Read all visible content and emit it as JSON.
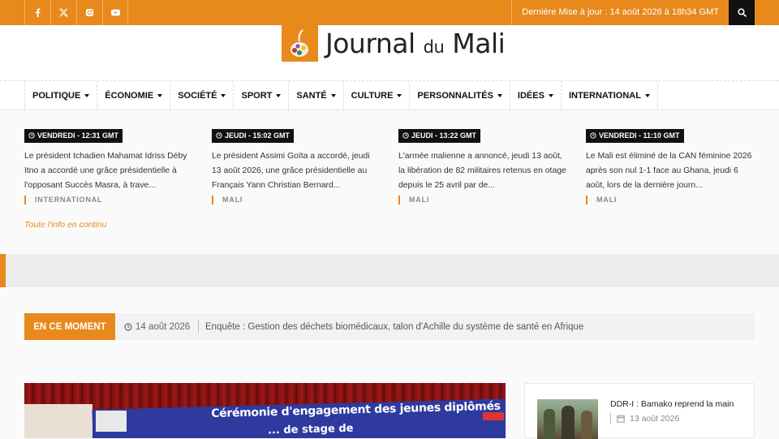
{
  "topbar": {
    "social_icons": [
      "facebook-icon",
      "x-twitter-icon",
      "instagram-icon",
      "youtube-icon"
    ],
    "updated_text": "Dernière Mise à jour : 14 août 2026 à 18h34 GMT",
    "accent_color": "#e8891c"
  },
  "header": {
    "logo_text_main": "Journal",
    "logo_text_du": "du",
    "logo_text_end": "Mali"
  },
  "nav": {
    "items": [
      {
        "label": "POLITIQUE"
      },
      {
        "label": "ÉCONOMIE"
      },
      {
        "label": "SOCIÉTÉ"
      },
      {
        "label": "SPORT"
      },
      {
        "label": "SANTÉ"
      },
      {
        "label": "CULTURE"
      },
      {
        "label": "PERSONNALITÉS"
      },
      {
        "label": "IDÉES"
      },
      {
        "label": "INTERNATIONAL"
      }
    ]
  },
  "latest": {
    "items": [
      {
        "time": "VENDREDI - 12:31 GMT",
        "text": "Le président tchadien Mahamat Idriss Déby Itno a accordé une grâce présidentielle à l'opposant Succès Masra, à trave...",
        "category": "INTERNATIONAL"
      },
      {
        "time": "JEUDI - 15:02 GMT",
        "text": "Le président Assimi Goïta a accordé, jeudi 13 août 2026, une grâce présidentielle au Français Yann Christian Bernard...",
        "category": "MALI"
      },
      {
        "time": "JEUDI - 13:22 GMT",
        "text": "L'armée malienne a annoncé, jeudi 13 août, la libération de 82 militaires retenus en otage depuis le 25 avril par de...",
        "category": "MALI"
      },
      {
        "time": "VENDREDI - 11:10 GMT",
        "text": "Le Mali est éliminé de la CAN féminine 2026 après son nul 1-1 face au Ghana, jeudi 6 août, lors de la dernière journ...",
        "category": "MALI"
      }
    ],
    "continu_link": "Toute l'info en continu"
  },
  "ticker": {
    "label": "EN CE MOMENT",
    "date": "14 août 2026",
    "headline": "Enquête : Gestion des déchets biomédicaux, talon d'Achille du système de santé en Afrique"
  },
  "feature": {
    "banner_line1": "Cérémonie d'engagement des jeunes diplômés",
    "banner_line2": "... de stage de"
  },
  "sidebar": {
    "items": [
      {
        "title": "DDR-I : Bamako reprend la main",
        "date": "13 août 2026"
      }
    ]
  }
}
